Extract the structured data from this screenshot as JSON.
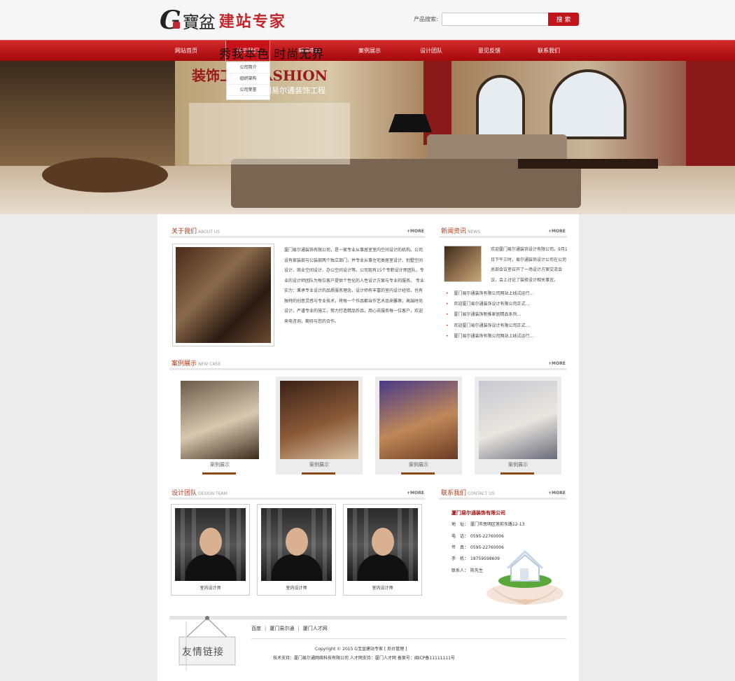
{
  "header": {
    "logo_g": "G",
    "logo_brand": "寶盆",
    "logo_slogan": "建站专家",
    "search_label": "产品搜索:",
    "search_value": "",
    "search_button": "搜 索"
  },
  "nav": {
    "items": [
      "网站首页",
      "关于我们",
      "新闻中心",
      "案例展示",
      "设计团队",
      "意见反馈",
      "联系我们"
    ],
    "active_index": 1,
    "dropdown": [
      "公司简介",
      "组织架构",
      "公司荣誉"
    ]
  },
  "banner": {
    "line1": "秀我本色 时尚无界",
    "line2": "装饰工程 FASHION",
    "line3": "厦门易尔通装饰工程"
  },
  "about": {
    "title": "关于我们",
    "title_en": "ABOUT US",
    "more": "+MORE",
    "text": "厦门易尔通装饰有限公司，是一家专业从事居室室内空间设计的机构。公司设有家装部与公装部两个独立部门，并专业从事住宅类居室设计、别墅空间设计、商业空间设计、办公空间设计等。公司现有15个专职设计师团队，专业的设计师团队为每位客户提供个性化的人性设计方案与专业的服务。  专业实力：秉承专业设计的品质服务理念，设计师有丰富的室内设计经验，也有独特的创意灵感与专业技术，将每一个作品都当作艺术品来雕琢，高端时尚设计，严谨专业的施工，努力打造精品作品，用心去服务每一位客户，欢迎来电咨询，期待与您的合作。"
  },
  "news": {
    "title": "新闻资讯",
    "title_en": "NEWS",
    "more": "+MORE",
    "intro": "欢迎厦门易尔通装饰设计有限公司。9月1日下午三时，易尔通装饰设计公司在公司总部会议室召开了一场设计方案交流会议，会上讨论了装修设计相关事宜。",
    "items": [
      "厦门易尔通装饰有限公司网站上线试运行...",
      "欢迎厦门易尔通装饰设计有限公司正式...",
      "厦门易尔通装饰新推家居精品系列...",
      "欢迎厦门易尔通装饰设计有限公司正式...",
      "厦门易尔通装饰有限公司网站上线试运行..."
    ]
  },
  "cases": {
    "title": "案例展示",
    "title_en": "NEW CASE",
    "more": "+MORE",
    "items": [
      {
        "label": "案例展示",
        "c1": "#6a5a48",
        "c2": "#d8c8b0",
        "c3": "#3a2a1a"
      },
      {
        "label": "案例展示",
        "c1": "#3a2218",
        "c2": "#8a5a38",
        "c3": "#d8c0a0"
      },
      {
        "label": "案例展示",
        "c1": "#4a3a88",
        "c2": "#c08858",
        "c3": "#6a3a22"
      },
      {
        "label": "案例展示",
        "c1": "#c8c8d0",
        "c2": "#e8e6e0",
        "c3": "#6a6a78"
      }
    ]
  },
  "team": {
    "title": "设计团队",
    "title_en": "DESIGN TEAM",
    "more": "+MORE",
    "members": [
      {
        "label": "室内设计师"
      },
      {
        "label": "室内设计师"
      },
      {
        "label": "室内设计师"
      }
    ]
  },
  "contact": {
    "title": "联系我们",
    "title_en": "CONTACT US",
    "more": "+MORE",
    "company": "厦门易尔通装饰有限公司",
    "address": "地　址：　厦门市思明区莲前东路12-13",
    "phone": "电　话：　0595-22760006",
    "fax": "传　真：　0595-22760006",
    "mobile": "手　机：　18759598609",
    "person": "联系人：　陈先生"
  },
  "footer": {
    "friend_links_title": "友情链接",
    "links": [
      "百度",
      "厦门易尔通",
      "厦门人才网"
    ],
    "copyright": "Copyright © 2015 G宝盆建站专家 [ 后台管理 ]",
    "support": "技术支持：厦门易尔通网络科技有限公司 人才网支持：厦门人才网 备案号：闽ICP备11111111号"
  },
  "colors": {
    "brand_red": "#c2151b",
    "title_brown": "#b03a1a"
  }
}
